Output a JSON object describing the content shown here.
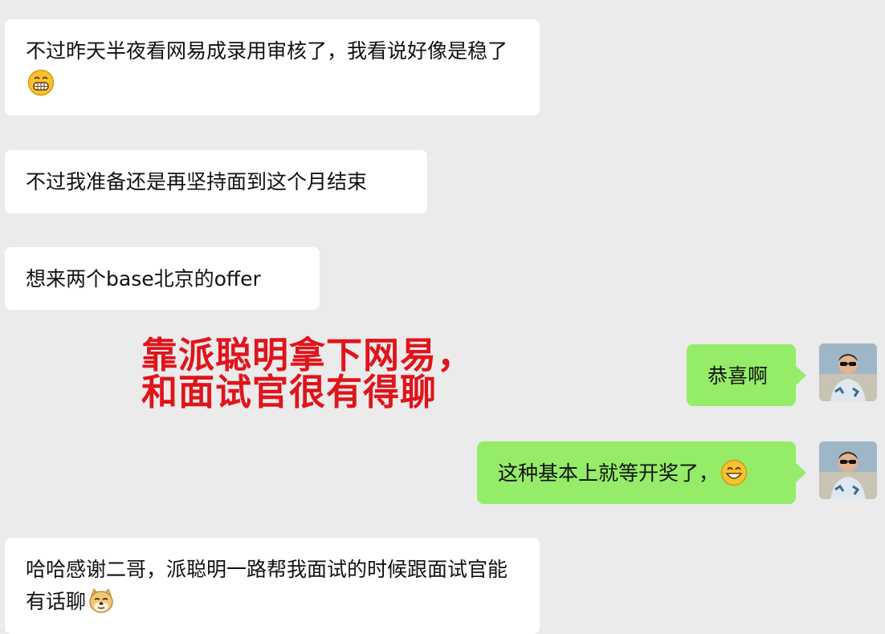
{
  "messages": {
    "m1": {
      "text": "不过昨天半夜看网易成录用审核了，我看说好像是稳了",
      "emoji": "grinning-face-emoji"
    },
    "m2": {
      "text": "不过我准备还是再坚持面到这个月结束"
    },
    "m3": {
      "text": "想来两个base北京的offer"
    },
    "m4": {
      "text": "恭喜啊"
    },
    "m5": {
      "text": "这种基本上就等开奖了，",
      "emoji": "smiling-face-emoji"
    },
    "m6": {
      "text": "哈哈感谢二哥，派聪明一路帮我面试的时候跟面试官能有话聊",
      "emoji": "doge-emoji"
    }
  },
  "overlay": {
    "line1": "靠派聪明拿下网易，",
    "line2": "和面试官很有得聊"
  },
  "colors": {
    "background": "#ebebeb",
    "incoming_bubble": "#ffffff",
    "outgoing_bubble": "#95ec69",
    "overlay_text": "#e0141b"
  }
}
